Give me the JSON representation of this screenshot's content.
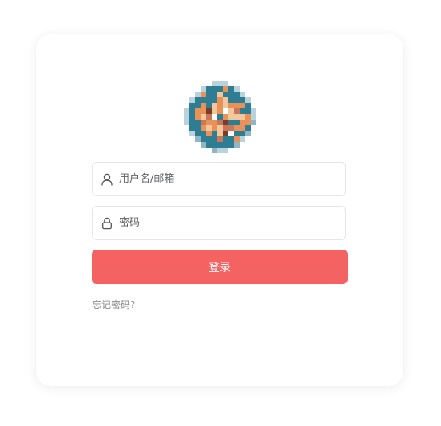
{
  "login": {
    "username_placeholder": "用户名/邮箱",
    "password_placeholder": "密码",
    "submit_label": "登录",
    "forgot_link": "忘记密码?"
  },
  "icons": {
    "user": "user-icon",
    "lock": "lock-icon"
  },
  "colors": {
    "primary": "#f56262",
    "border": "#e6e6e6",
    "muted_text": "#8c8c8c"
  }
}
